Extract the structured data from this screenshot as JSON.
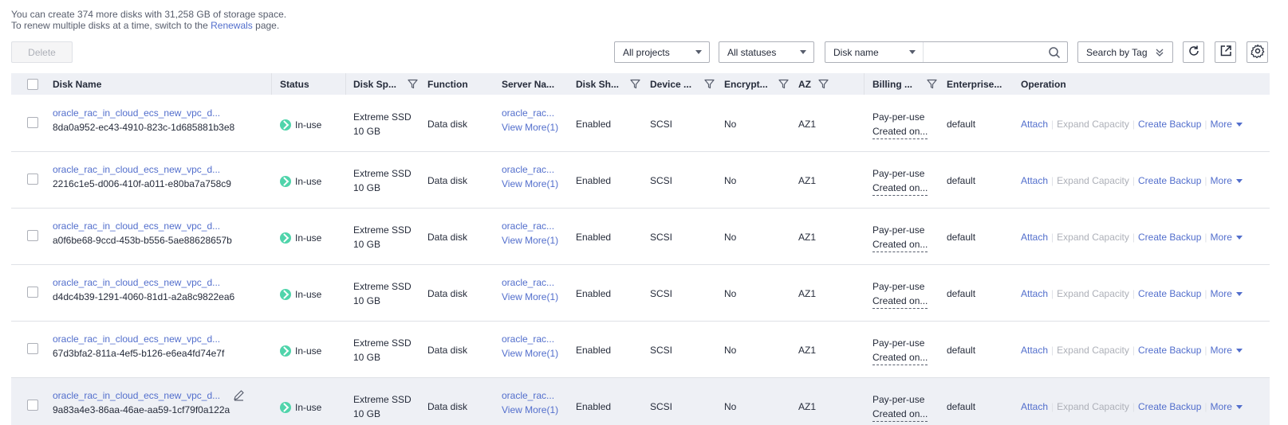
{
  "info": {
    "line1": "You can create 374 more disks with 31,258 GB of storage space.",
    "line2_prefix": "To renew multiple disks at a time, switch to the ",
    "line2_link": "Renewals",
    "line2_suffix": " page."
  },
  "toolbar": {
    "delete_label": "Delete",
    "projects_value": "All projects",
    "statuses_value": "All statuses",
    "search_field_value": "Disk name",
    "search_placeholder": "",
    "tag_label": "Search by Tag"
  },
  "columns": {
    "disk_name": "Disk Name",
    "status": "Status",
    "disk_spec": "Disk Sp...",
    "function": "Function",
    "server_name": "Server Na...",
    "disk_sharing": "Disk Sh...",
    "device_type": "Device ...",
    "encryption": "Encrypt...",
    "az": "AZ",
    "billing": "Billing ...",
    "enterprise": "Enterprise...",
    "operation": "Operation"
  },
  "rows": [
    {
      "name": "oracle_rac_in_cloud_ecs_new_vpc_d...",
      "id": "8da0a952-ec43-4910-823c-1d685881b3e8",
      "status": "In-use",
      "spec_type": "Extreme SSD",
      "spec_size": "10 GB",
      "function": "Data disk",
      "server": "oracle_rac...",
      "server_more": "View More(1)",
      "sharing": "Enabled",
      "device": "SCSI",
      "encryption": "No",
      "az": "AZ1",
      "billing": "Pay-per-use",
      "created": "Created on...",
      "enterprise": "default"
    },
    {
      "name": "oracle_rac_in_cloud_ecs_new_vpc_d...",
      "id": "2216c1e5-d006-410f-a011-e80ba7a758c9",
      "status": "In-use",
      "spec_type": "Extreme SSD",
      "spec_size": "10 GB",
      "function": "Data disk",
      "server": "oracle_rac...",
      "server_more": "View More(1)",
      "sharing": "Enabled",
      "device": "SCSI",
      "encryption": "No",
      "az": "AZ1",
      "billing": "Pay-per-use",
      "created": "Created on...",
      "enterprise": "default"
    },
    {
      "name": "oracle_rac_in_cloud_ecs_new_vpc_d...",
      "id": "a0f6be68-9ccd-453b-b556-5ae88628657b",
      "status": "In-use",
      "spec_type": "Extreme SSD",
      "spec_size": "10 GB",
      "function": "Data disk",
      "server": "oracle_rac...",
      "server_more": "View More(1)",
      "sharing": "Enabled",
      "device": "SCSI",
      "encryption": "No",
      "az": "AZ1",
      "billing": "Pay-per-use",
      "created": "Created on...",
      "enterprise": "default"
    },
    {
      "name": "oracle_rac_in_cloud_ecs_new_vpc_d...",
      "id": "d4dc4b39-1291-4060-81d1-a2a8c9822ea6",
      "status": "In-use",
      "spec_type": "Extreme SSD",
      "spec_size": "10 GB",
      "function": "Data disk",
      "server": "oracle_rac...",
      "server_more": "View More(1)",
      "sharing": "Enabled",
      "device": "SCSI",
      "encryption": "No",
      "az": "AZ1",
      "billing": "Pay-per-use",
      "created": "Created on...",
      "enterprise": "default"
    },
    {
      "name": "oracle_rac_in_cloud_ecs_new_vpc_d...",
      "id": "67d3bfa2-811a-4ef5-b126-e6ea4fd74e7f",
      "status": "In-use",
      "spec_type": "Extreme SSD",
      "spec_size": "10 GB",
      "function": "Data disk",
      "server": "oracle_rac...",
      "server_more": "View More(1)",
      "sharing": "Enabled",
      "device": "SCSI",
      "encryption": "No",
      "az": "AZ1",
      "billing": "Pay-per-use",
      "created": "Created on...",
      "enterprise": "default"
    },
    {
      "name": "oracle_rac_in_cloud_ecs_new_vpc_d...",
      "id": "9a83a4e3-86aa-46ae-aa59-1cf79f0a122a",
      "status": "In-use",
      "spec_type": "Extreme SSD",
      "spec_size": "10 GB",
      "function": "Data disk",
      "server": "oracle_rac...",
      "server_more": "View More(1)",
      "sharing": "Enabled",
      "device": "SCSI",
      "encryption": "No",
      "az": "AZ1",
      "billing": "Pay-per-use",
      "created": "Created on...",
      "enterprise": "default"
    }
  ],
  "operations": {
    "attach": "Attach",
    "expand": "Expand Capacity",
    "backup": "Create Backup",
    "more": "More"
  },
  "colors": {
    "link": "#526ecc",
    "status_ok": "#50d4ab",
    "header_bg": "#eef0f5",
    "disabled_text": "#adb0b8"
  }
}
